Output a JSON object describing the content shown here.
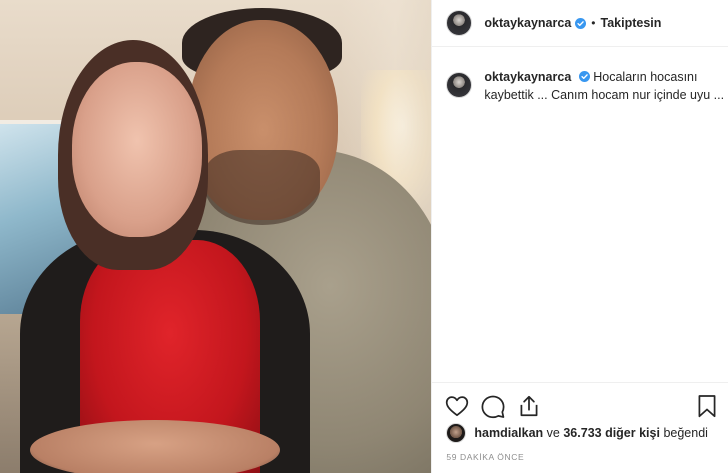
{
  "post": {
    "author": {
      "username": "oktaykaynarca",
      "verified": true,
      "follow_status": "Takiptesin"
    },
    "caption": {
      "username": "oktaykaynarca",
      "text": "Hocaların hocasını kaybettik ... Canım hocam nur içinde uyu ..."
    },
    "likes": {
      "liker_username": "hamdialkan",
      "connector": "ve",
      "others_count": "36.733 diğer kişi",
      "suffix": "beğendi"
    },
    "timestamp": "59 DAKİKA ÖNCE",
    "icons": {
      "verified": "verified-badge-icon",
      "like": "heart-icon",
      "comment": "comment-bubble-icon",
      "share": "share-icon",
      "save": "bookmark-icon"
    },
    "colors": {
      "verified_blue": "#3897f0",
      "text": "#262626",
      "muted": "#8e8e8e",
      "border": "#efefef"
    }
  }
}
